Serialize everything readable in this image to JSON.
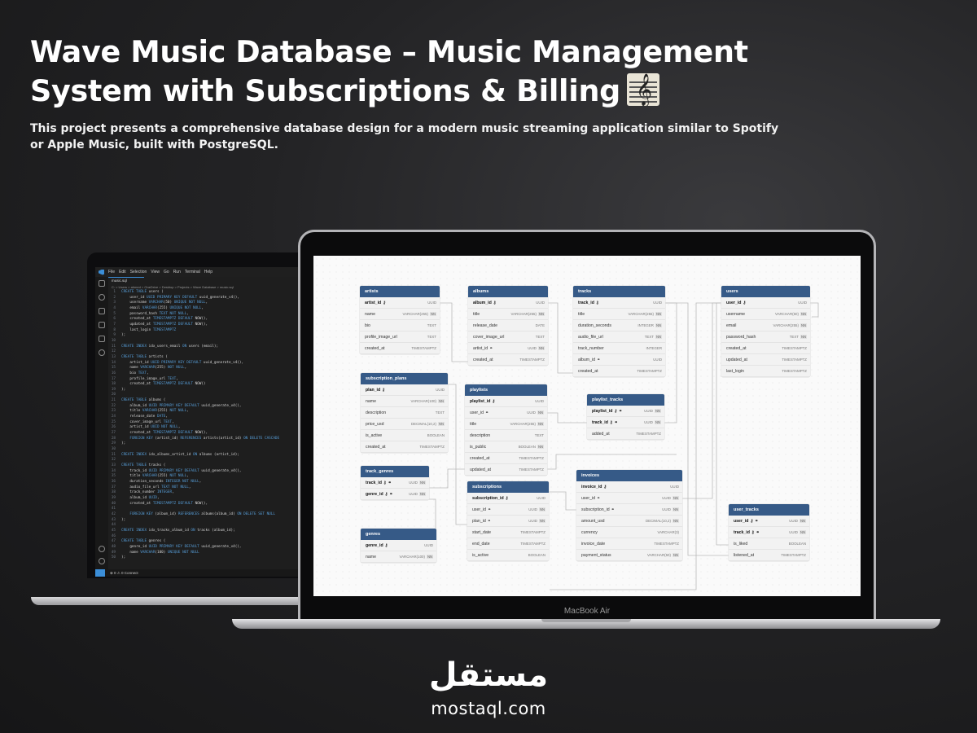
{
  "headline": "Wave Music Database – Music Management System with Subscriptions & Billing",
  "subtitle": "This project presents a comprehensive database design for a modern music streaming application similar to Spotify or Apple Music, built with PostgreSQL.",
  "vscode": {
    "menu": [
      "File",
      "Edit",
      "Selection",
      "View",
      "Go",
      "Run",
      "Terminal",
      "Help"
    ],
    "tab": "music.sql",
    "breadcrumb": "C: > Users > ahmed > OneDrive > Desktop > Projects > Wave Database > music.sql",
    "status": "⊗ 0 ⚠ 0   Connect",
    "code": [
      [
        "1",
        "CREATE TABLE users ("
      ],
      [
        "2",
        "    user_id UUID PRIMARY KEY DEFAULT uuid_generate_v4(),"
      ],
      [
        "3",
        "    username VARCHAR(50) UNIQUE NOT NULL,"
      ],
      [
        "4",
        "    email VARCHAR(255) UNIQUE NOT NULL,"
      ],
      [
        "5",
        "    password_hash TEXT NOT NULL,"
      ],
      [
        "6",
        "    created_at TIMESTAMPTZ DEFAULT NOW(),"
      ],
      [
        "7",
        "    updated_at TIMESTAMPTZ DEFAULT NOW(),"
      ],
      [
        "8",
        "    last_login TIMESTAMPTZ"
      ],
      [
        "9",
        ");"
      ],
      [
        "10",
        ""
      ],
      [
        "11",
        "CREATE INDEX idx_users_email ON users (email);"
      ],
      [
        "12",
        ""
      ],
      [
        "13",
        "CREATE TABLE artists ("
      ],
      [
        "14",
        "    artist_id UUID PRIMARY KEY DEFAULT uuid_generate_v4(),"
      ],
      [
        "15",
        "    name VARCHAR(255) NOT NULL,"
      ],
      [
        "16",
        "    bio TEXT,"
      ],
      [
        "17",
        "    profile_image_url TEXT,"
      ],
      [
        "18",
        "    created_at TIMESTAMPTZ DEFAULT NOW()"
      ],
      [
        "19",
        ");"
      ],
      [
        "20",
        ""
      ],
      [
        "21",
        "CREATE TABLE albums ("
      ],
      [
        "22",
        "    album_id UUID PRIMARY KEY DEFAULT uuid_generate_v4(),"
      ],
      [
        "23",
        "    title VARCHAR(255) NOT NULL,"
      ],
      [
        "24",
        "    release_date DATE,"
      ],
      [
        "25",
        "    cover_image_url TEXT,"
      ],
      [
        "26",
        "    artist_id UUID NOT NULL,"
      ],
      [
        "27",
        "    created_at TIMESTAMPTZ DEFAULT NOW(),"
      ],
      [
        "28",
        "    FOREIGN KEY (artist_id) REFERENCES artists(artist_id) ON DELETE CASCADE"
      ],
      [
        "29",
        ");"
      ],
      [
        "30",
        ""
      ],
      [
        "31",
        "CREATE INDEX idx_albums_artist_id ON albums (artist_id);"
      ],
      [
        "32",
        ""
      ],
      [
        "33",
        "CREATE TABLE tracks ("
      ],
      [
        "34",
        "    track_id UUID PRIMARY KEY DEFAULT uuid_generate_v4(),"
      ],
      [
        "35",
        "    title VARCHAR(255) NOT NULL,"
      ],
      [
        "36",
        "    duration_seconds INTEGER NOT NULL,"
      ],
      [
        "37",
        "    audio_file_url TEXT NOT NULL,"
      ],
      [
        "38",
        "    track_number INTEGER,"
      ],
      [
        "39",
        "    album_id UUID,"
      ],
      [
        "40",
        "    created_at TIMESTAMPTZ DEFAULT NOW(),"
      ],
      [
        "41",
        ""
      ],
      [
        "42",
        "    FOREIGN KEY (album_id) REFERENCES albums(album_id) ON DELETE SET NULL"
      ],
      [
        "43",
        ");"
      ],
      [
        "44",
        ""
      ],
      [
        "45",
        "CREATE INDEX idx_tracks_album_id ON tracks (album_id);"
      ],
      [
        "46",
        ""
      ],
      [
        "47",
        "CREATE TABLE genres ("
      ],
      [
        "48",
        "    genre_id UUID PRIMARY KEY DEFAULT uuid_generate_v4(),"
      ],
      [
        "49",
        "    name VARCHAR(100) UNIQUE NOT NULL"
      ],
      [
        "50",
        ");"
      ]
    ]
  },
  "macbook_label": "MacBook Air",
  "erd_tables": [
    {
      "name": "artists",
      "rows": [
        {
          "name": "artist_id",
          "type": "UUID",
          "pk": true
        },
        {
          "name": "name",
          "type": "VARCHAR(255)",
          "nn": true
        },
        {
          "name": "bio",
          "type": "TEXT"
        },
        {
          "name": "profile_image_url",
          "type": "TEXT"
        },
        {
          "name": "created_at",
          "type": "TIMESTAMPTZ"
        }
      ]
    },
    {
      "name": "albums",
      "rows": [
        {
          "name": "album_id",
          "type": "UUID",
          "pk": true
        },
        {
          "name": "title",
          "type": "VARCHAR(255)",
          "nn": true
        },
        {
          "name": "release_date",
          "type": "DATE"
        },
        {
          "name": "cover_image_url",
          "type": "TEXT"
        },
        {
          "name": "artist_id",
          "type": "UUID",
          "nn": true,
          "fk": true
        },
        {
          "name": "created_at",
          "type": "TIMESTAMPTZ"
        }
      ]
    },
    {
      "name": "tracks",
      "rows": [
        {
          "name": "track_id",
          "type": "UUID",
          "pk": true
        },
        {
          "name": "title",
          "type": "VARCHAR(255)",
          "nn": true
        },
        {
          "name": "duration_seconds",
          "type": "INTEGER",
          "nn": true
        },
        {
          "name": "audio_file_url",
          "type": "TEXT",
          "nn": true
        },
        {
          "name": "track_number",
          "type": "INTEGER"
        },
        {
          "name": "album_id",
          "type": "UUID",
          "fk": true
        },
        {
          "name": "created_at",
          "type": "TIMESTAMPTZ"
        }
      ]
    },
    {
      "name": "users",
      "rows": [
        {
          "name": "user_id",
          "type": "UUID",
          "pk": true
        },
        {
          "name": "username",
          "type": "VARCHAR(50)",
          "nn": true
        },
        {
          "name": "email",
          "type": "VARCHAR(255)",
          "nn": true
        },
        {
          "name": "password_hash",
          "type": "TEXT",
          "nn": true
        },
        {
          "name": "created_at",
          "type": "TIMESTAMPTZ"
        },
        {
          "name": "updated_at",
          "type": "TIMESTAMPTZ"
        },
        {
          "name": "last_login",
          "type": "TIMESTAMPTZ"
        }
      ]
    },
    {
      "name": "subscription_plans",
      "rows": [
        {
          "name": "plan_id",
          "type": "UUID",
          "pk": true
        },
        {
          "name": "name",
          "type": "VARCHAR(100)",
          "nn": true
        },
        {
          "name": "description",
          "type": "TEXT"
        },
        {
          "name": "price_usd",
          "type": "DECIMAL(10,2)",
          "nn": true
        },
        {
          "name": "is_active",
          "type": "BOOLEAN"
        },
        {
          "name": "created_at",
          "type": "TIMESTAMPTZ"
        }
      ]
    },
    {
      "name": "playlists",
      "rows": [
        {
          "name": "playlist_id",
          "type": "UUID",
          "pk": true
        },
        {
          "name": "user_id",
          "type": "UUID",
          "nn": true,
          "fk": true
        },
        {
          "name": "title",
          "type": "VARCHAR(255)",
          "nn": true
        },
        {
          "name": "description",
          "type": "TEXT"
        },
        {
          "name": "is_public",
          "type": "BOOLEAN",
          "nn": true
        },
        {
          "name": "created_at",
          "type": "TIMESTAMPTZ"
        },
        {
          "name": "updated_at",
          "type": "TIMESTAMPTZ"
        }
      ]
    },
    {
      "name": "playlist_tracks",
      "rows": [
        {
          "name": "playlist_id",
          "type": "UUID",
          "nn": true,
          "pk": true,
          "fk": true
        },
        {
          "name": "track_id",
          "type": "UUID",
          "nn": true,
          "pk": true,
          "fk": true
        },
        {
          "name": "added_at",
          "type": "TIMESTAMPTZ"
        }
      ]
    },
    {
      "name": "track_genres",
      "rows": [
        {
          "name": "track_id",
          "type": "UUID",
          "nn": true,
          "pk": true,
          "fk": true
        },
        {
          "name": "genre_id",
          "type": "UUID",
          "nn": true,
          "pk": true,
          "fk": true
        }
      ]
    },
    {
      "name": "subscriptions",
      "rows": [
        {
          "name": "subscription_id",
          "type": "UUID",
          "pk": true
        },
        {
          "name": "user_id",
          "type": "UUID",
          "nn": true,
          "fk": true
        },
        {
          "name": "plan_id",
          "type": "UUID",
          "nn": true,
          "fk": true
        },
        {
          "name": "start_date",
          "type": "TIMESTAMPTZ"
        },
        {
          "name": "end_date",
          "type": "TIMESTAMPTZ"
        },
        {
          "name": "is_active",
          "type": "BOOLEAN"
        }
      ]
    },
    {
      "name": "invoices",
      "rows": [
        {
          "name": "invoice_id",
          "type": "UUID",
          "pk": true
        },
        {
          "name": "user_id",
          "type": "UUID",
          "nn": true,
          "fk": true
        },
        {
          "name": "subscription_id",
          "type": "UUID",
          "nn": true,
          "fk": true
        },
        {
          "name": "amount_usd",
          "type": "DECIMAL(10,2)",
          "nn": true
        },
        {
          "name": "currency",
          "type": "VARCHAR(3)"
        },
        {
          "name": "invoice_date",
          "type": "TIMESTAMPTZ"
        },
        {
          "name": "payment_status",
          "type": "VARCHAR(50)",
          "nn": true
        }
      ]
    },
    {
      "name": "genres",
      "rows": [
        {
          "name": "genre_id",
          "type": "UUID",
          "pk": true
        },
        {
          "name": "name",
          "type": "VARCHAR(100)",
          "nn": true
        }
      ]
    },
    {
      "name": "user_tracks",
      "rows": [
        {
          "name": "user_id",
          "type": "UUID",
          "nn": true,
          "pk": true,
          "fk": true
        },
        {
          "name": "track_id",
          "type": "UUID",
          "nn": true,
          "pk": true,
          "fk": true
        },
        {
          "name": "is_liked",
          "type": "BOOLEAN"
        },
        {
          "name": "listened_at",
          "type": "TIMESTAMPTZ"
        }
      ]
    }
  ],
  "logo": {
    "arabic": "مستقل",
    "latin": "mostaql.com"
  },
  "colors": {
    "table_header": "#365a87",
    "vscode_accent": "#3b8ed8",
    "background": "#232325"
  }
}
